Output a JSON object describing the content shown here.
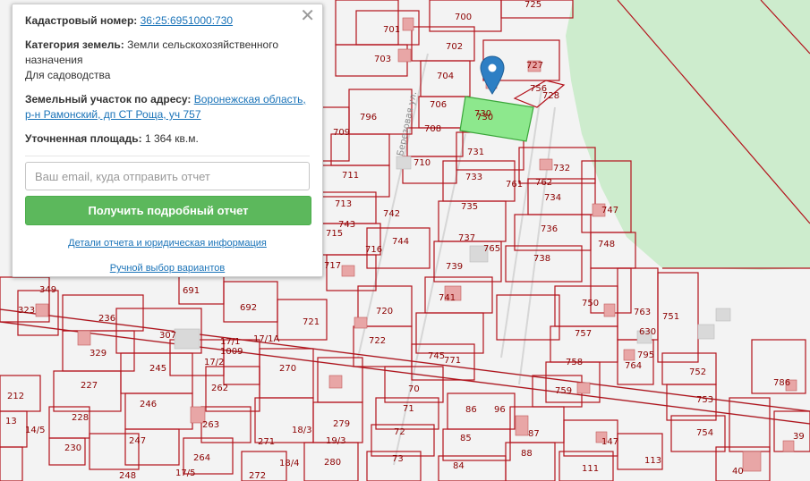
{
  "popup": {
    "cadastral_label": "Кадастровый номер:",
    "cadastral_value": "36:25:6951000:730",
    "category_label": "Категория земель:",
    "category_value": "Земли сельскохозяйственного назначения",
    "purpose": "Для садоводства",
    "address_label": "Земельный участок по адресу:",
    "address_value": "Воронежская область, р-н Рамонский, дп СТ Роща, уч 757",
    "area_label": "Уточненная площадь:",
    "area_value": "1 364 кв.м.",
    "email_placeholder": "Ваш email, куда отправить отчет",
    "submit_label": "Получить подробный отчет",
    "details_link": "Детали отчета и юридическая информация",
    "manual_link": "Ручной выбор вариантов",
    "close_glyph": "✕"
  },
  "map": {
    "street_label": "Березовая ул.",
    "selected_parcel": "730",
    "colors": {
      "boundary": "#b3121b",
      "label": "#8b0000",
      "selected_fill": "#8de88d",
      "forest": "#cdeccd",
      "building": "#e8a6a6",
      "marker": "#2d7fc4"
    },
    "parcel_labels_top": [
      "700",
      "701",
      "702",
      "703",
      "704",
      "706",
      "708",
      "710",
      "711",
      "713",
      "715",
      "725",
      "727",
      "728",
      "730",
      "731",
      "732",
      "733",
      "734",
      "735",
      "736",
      "737",
      "738",
      "739",
      "741",
      "742",
      "743",
      "744",
      "745",
      "747",
      "748",
      "750",
      "751",
      "752",
      "753",
      "754",
      "756",
      "757",
      "758",
      "759",
      "761",
      "762",
      "763",
      "764",
      "765",
      "771",
      "786",
      "796",
      "709"
    ],
    "parcel_labels_bottom": [
      "323",
      "329",
      "349",
      "307",
      "236",
      "245",
      "246",
      "247",
      "248",
      "227",
      "228",
      "230",
      "212",
      "13",
      "17/1",
      "17/2",
      "17/1A",
      "1009",
      "262",
      "263",
      "264",
      "270",
      "271",
      "272",
      "279",
      "280",
      "70",
      "71",
      "72",
      "73",
      "84",
      "85",
      "86",
      "87",
      "88",
      "96",
      "111",
      "113",
      "147",
      "40",
      "39",
      "691",
      "692",
      "716",
      "717",
      "720",
      "721",
      "722",
      "730",
      "630",
      "795",
      "18/3",
      "18/4",
      "19/3",
      "14/5",
      "17/5"
    ]
  }
}
